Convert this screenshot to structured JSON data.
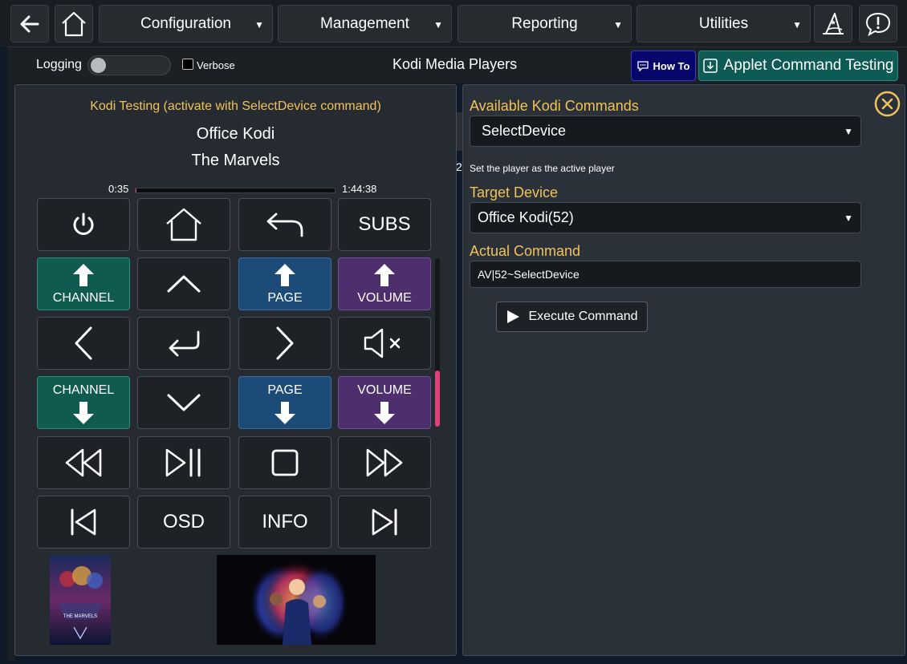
{
  "topbar": {
    "menus": [
      {
        "label": "Configuration"
      },
      {
        "label": "Management"
      },
      {
        "label": "Reporting"
      },
      {
        "label": "Utilities"
      }
    ]
  },
  "subbar": {
    "logging_label": "Logging",
    "verbose_label": "Verbose",
    "title": "Kodi Media Players",
    "howto_label": "How To",
    "applet_label": "Applet Command Testing"
  },
  "remote": {
    "hint": "Kodi Testing (activate with SelectDevice command)",
    "device": "Office Kodi",
    "media_title": "The Marvels",
    "time_elapsed": "0:35",
    "time_total": "1:44:38",
    "progress_fraction": 0.006,
    "buttons": {
      "subs": "SUBS",
      "channel_up": "CHANNEL",
      "page_up": "PAGE",
      "volume_up": "VOLUME",
      "channel_down": "CHANNEL",
      "page_down": "PAGE",
      "volume_down": "VOLUME",
      "osd": "OSD",
      "info": "INFO"
    },
    "poster_text": "THE MARVELS"
  },
  "commands": {
    "available_label": "Available Kodi Commands",
    "selected_command": "SelectDevice",
    "command_description": "Set the player as the active player",
    "target_label": "Target Device",
    "target_device": "Office Kodi(52)",
    "actual_label": "Actual Command",
    "actual_command": "AV|52~SelectDevice",
    "execute_label": "Execute Command",
    "side_number": "2"
  },
  "colors": {
    "accent_gold": "#f0c35a",
    "teal": "#0f5b4f",
    "blue": "#1d4b78",
    "purple": "#4e2f6e",
    "progress": "#e04080"
  }
}
